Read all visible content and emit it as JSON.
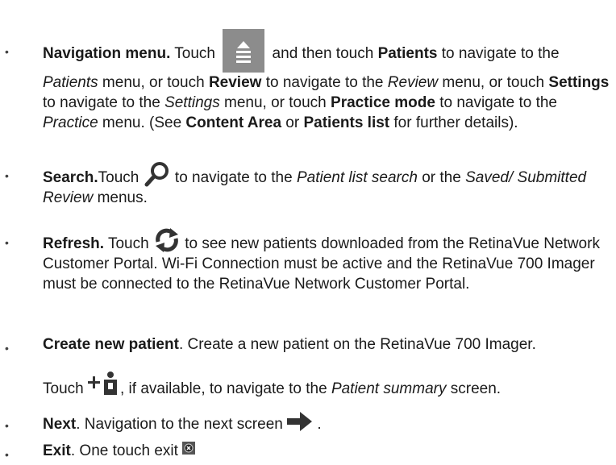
{
  "items": [
    {
      "title": "Navigation menu.",
      "t1": " Touch ",
      "t2": " and then touch ",
      "patients": "Patients",
      "t3": " to navigate to the ",
      "patients_menu": "Patients",
      "t4": " menu, or touch ",
      "review": "Review",
      "t5": " to navigate to the ",
      "review_menu": "Review",
      "t6": " menu, or touch ",
      "settings": "Settings",
      "t7": " to navigate to the ",
      "settings_menu": "Settings",
      "t8": " menu, or touch ",
      "practice_mode": "Practice mode",
      "t9": " to navigate to the ",
      "practice_menu": "Practice",
      "t10": " menu. (See ",
      "content_area": "Content Area",
      "t11": " or ",
      "patients_list": "Patients list",
      "t12": " for further details)."
    },
    {
      "title": "Search.",
      "t1": "Touch ",
      "t2": " to navigate to the ",
      "pls": "Patient list search",
      "t3": " or the ",
      "saved": "Saved/ Submitted Review",
      "t4": " menus."
    },
    {
      "title": "Refresh.",
      "t1": " Touch ",
      "t2": " to see new patients downloaded from the RetinaVue Network Customer Portal. Wi-Fi Connection must be active and the RetinaVue 700 Imager must be connected to the RetinaVue Network Customer Portal."
    },
    {
      "title": "Create new patient",
      "t1": ". Create a new patient on the RetinaVue 700 Imager.",
      "t2": "Touch ",
      "t3": ", if available, to navigate to the ",
      "ps": "Patient summary",
      "t4": " screen."
    },
    {
      "title": "Next",
      "t1": ". Navigation to the next screen ",
      "t2": " ."
    },
    {
      "title": "Exit",
      "t1": ". One touch exit "
    }
  ],
  "bullet": "•",
  "icons": {
    "menu": "menu-eject-icon",
    "search": "search-icon",
    "refresh": "refresh-icon",
    "new_patient": "add-patient-icon",
    "next": "arrow-right-icon",
    "exit": "close-icon"
  }
}
